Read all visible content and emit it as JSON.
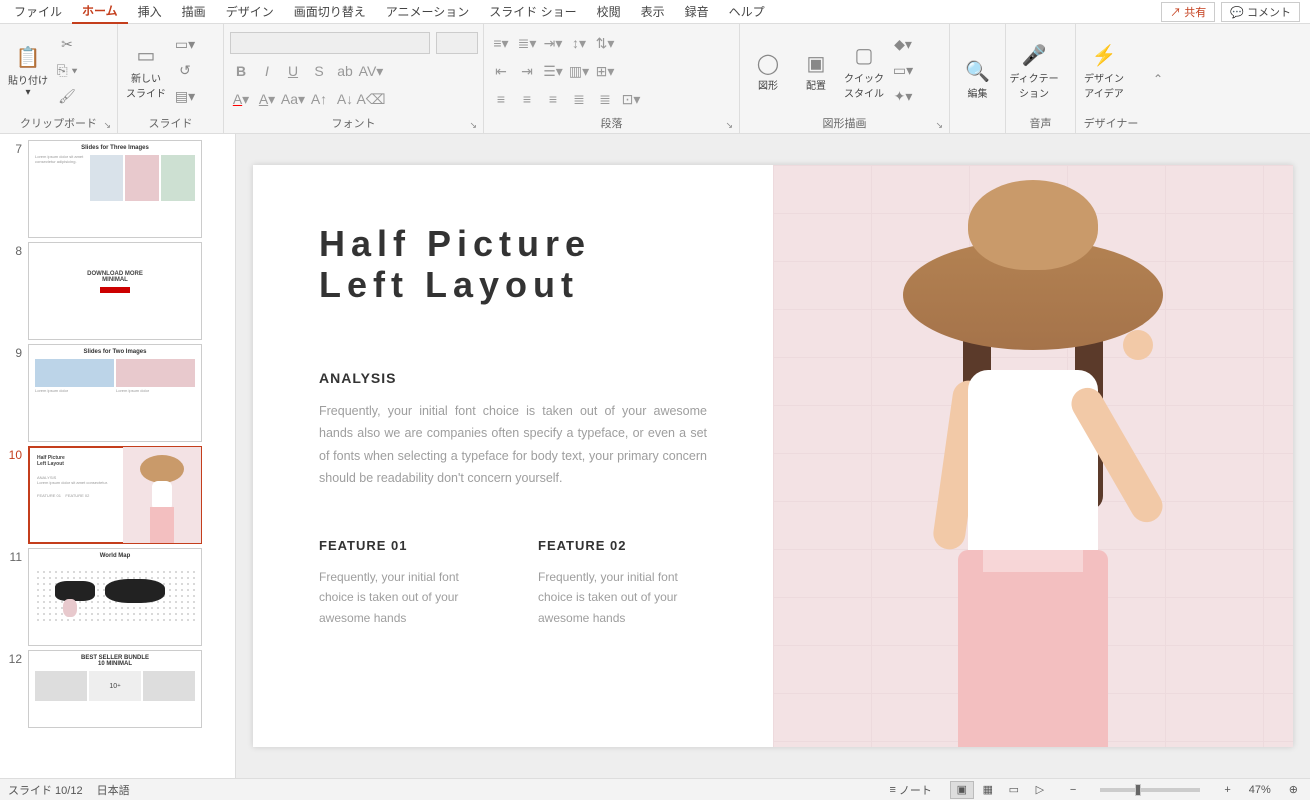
{
  "tabs": {
    "file": "ファイル",
    "home": "ホーム",
    "insert": "挿入",
    "draw": "描画",
    "design": "デザイン",
    "transitions": "画面切り替え",
    "animations": "アニメーション",
    "slideshow": "スライド ショー",
    "review": "校閲",
    "view": "表示",
    "record": "録音",
    "help": "ヘルプ",
    "share": "共有",
    "comment": "コメント"
  },
  "ribbon": {
    "clipboard": {
      "label": "クリップボード",
      "paste": "貼り付け"
    },
    "slides": {
      "label": "スライド",
      "newSlide": "新しい\nスライド"
    },
    "font": {
      "label": "フォント"
    },
    "paragraph": {
      "label": "段落"
    },
    "drawing": {
      "label": "図形描画",
      "shapes": "図形",
      "arrange": "配置",
      "quickStyles": "クイック\nスタイル"
    },
    "editing": {
      "label": "編集"
    },
    "voice": {
      "label": "音声",
      "dictate": "ディクテー\nション"
    },
    "designer": {
      "label": "デザイナー",
      "ideas": "デザイン\nアイデア"
    }
  },
  "slide": {
    "title_line1": "Half Picture",
    "title_line2": "Left Layout",
    "analysis_h": "ANALYSIS",
    "analysis_body": "Frequently, your initial font choice is taken out of your awesome hands also we are companies often specify a typeface, or even a set of fonts when selecting a typeface for body text, your primary concern should be readability don't concern yourself.",
    "feat1_h": "FEATURE 01",
    "feat1_body": "Frequently, your initial font choice is taken out of your awesome hands",
    "feat2_h": "FEATURE 02",
    "feat2_body": "Frequently, your initial font choice is taken out of your awesome hands"
  },
  "thumbs": {
    "7": "Slides for Three Images",
    "8a": "DOWNLOAD MORE",
    "8b": "MINIMAL",
    "9": "Slides for Two Images",
    "10a": "Half Picture",
    "10b": "Left Layout",
    "11": "World Map",
    "12a": "BEST SELLER BUNDLE",
    "12b": "10 MINIMAL"
  },
  "status": {
    "slide": "スライド 10/12",
    "lang": "日本語",
    "notes": "ノート",
    "zoom": "47%"
  }
}
